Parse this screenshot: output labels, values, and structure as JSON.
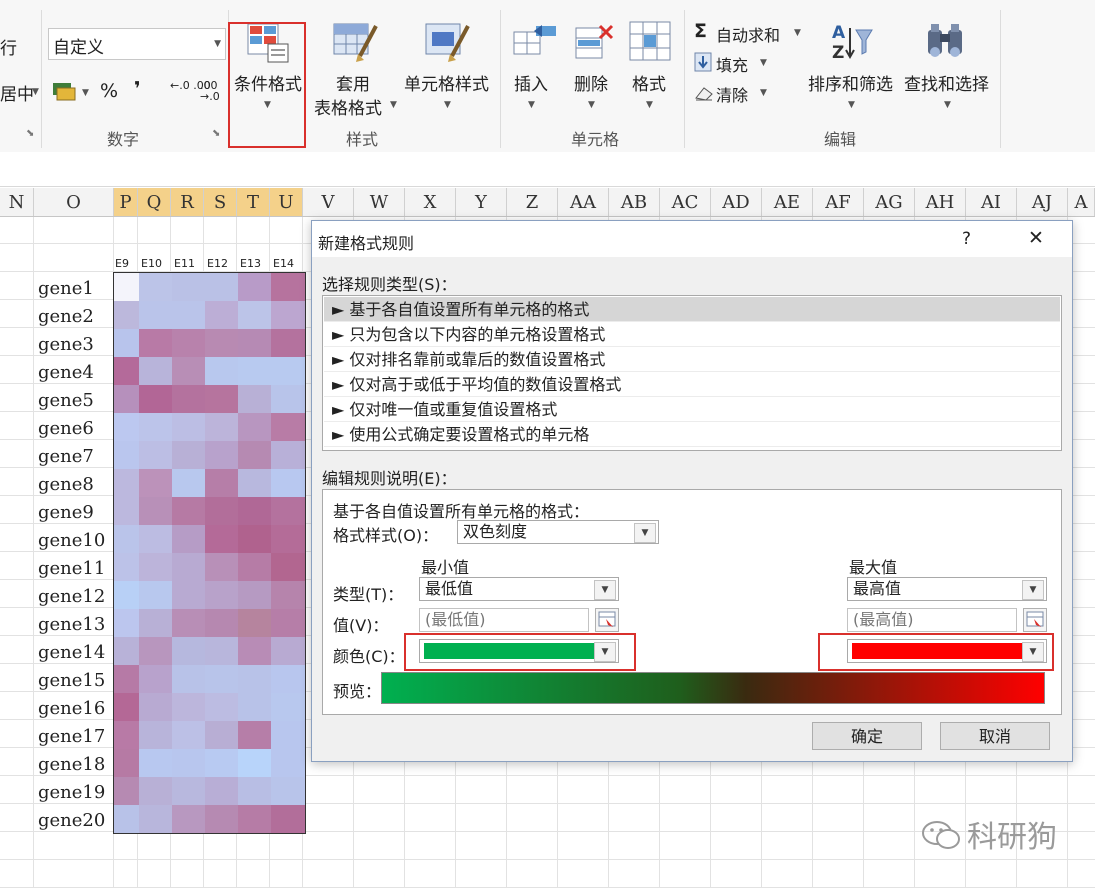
{
  "ribbon": {
    "left_partial_top": "行",
    "left_partial_bottom": "居中",
    "number_format_value": "自定义",
    "percent_glyph": "%",
    "comma_glyph": "❜",
    "decimal_increase": "←.0 .00",
    "decimal_decrease": ".00 →.0",
    "group_number_label": "数字",
    "conditional_format_label": "条件格式",
    "table_format_label_top": "套用",
    "table_format_label_bottom": "表格格式",
    "cell_style_label": "单元格样式",
    "group_styles_label": "样式",
    "insert_label": "插入",
    "delete_label": "删除",
    "format_label": "格式",
    "group_cells_label": "单元格",
    "autosum_glyph": "Σ",
    "autosum_label": "自动求和",
    "fill_label": "填充",
    "clear_label": "清除",
    "sort_filter_label": "排序和筛选",
    "find_select_label": "查找和选择",
    "group_edit_label": "编辑"
  },
  "sheet": {
    "columns": [
      "N",
      "O",
      "P",
      "Q",
      "R",
      "S",
      "T",
      "U",
      "V",
      "W",
      "X",
      "Y",
      "Z",
      "AA",
      "AB",
      "AC",
      "AD",
      "AE",
      "AF",
      "AG",
      "AH",
      "AI",
      "AJ",
      "A"
    ],
    "sample_headers": [
      "E9",
      "E10",
      "E11",
      "E12",
      "E13",
      "E14"
    ],
    "genes": [
      "gene1",
      "gene2",
      "gene3",
      "gene4",
      "gene5",
      "gene6",
      "gene7",
      "gene8",
      "gene9",
      "gene10",
      "gene11",
      "gene12",
      "gene13",
      "gene14",
      "gene15",
      "gene16",
      "gene17",
      "gene18",
      "gene19",
      "gene20"
    ],
    "heat_colors": [
      [
        "#f4f4fb",
        "#bcc4e8",
        "#bac1e6",
        "#bac1e6",
        "#b89bc8",
        "#b6739e"
      ],
      [
        "#bcb8dc",
        "#bac4ea",
        "#bac4ea",
        "#bcaed6",
        "#bcc4e8",
        "#bca6d0"
      ],
      [
        "#b8c4ec",
        "#b87aa6",
        "#b882ac",
        "#b88ab2",
        "#b68ab4",
        "#b4729e"
      ],
      [
        "#b46a9a",
        "#b8b4da",
        "#b88eb6",
        "#b8c8ee",
        "#b8caf0",
        "#b8caf0"
      ],
      [
        "#b690bc",
        "#b26696",
        "#b4729e",
        "#b6749e",
        "#b8b0d6",
        "#b8c4ea"
      ],
      [
        "#bcc8f0",
        "#bcc4ea",
        "#bcbee4",
        "#bcb4da",
        "#b896c0",
        "#b87ca6"
      ],
      [
        "#bac6ee",
        "#bcbee4",
        "#b8b0d6",
        "#b8a2cc",
        "#b68ab2",
        "#b8b0d8"
      ],
      [
        "#bcb8de",
        "#bc92ba",
        "#b8c8ee",
        "#b67ea8",
        "#b8b8de",
        "#b8c8f0"
      ],
      [
        "#bcb8de",
        "#b890b8",
        "#b67aa4",
        "#b26e9a",
        "#b06896",
        "#b4729e"
      ],
      [
        "#bac4ea",
        "#bcbce2",
        "#b69cc6",
        "#b46a98",
        "#b0628e",
        "#b46c98"
      ],
      [
        "#bcc2e8",
        "#bcb4da",
        "#b8aad2",
        "#b890b8",
        "#b67ca6",
        "#b26690"
      ],
      [
        "#b8d0f6",
        "#b8c8ee",
        "#b8aad2",
        "#b8a2ca",
        "#b69ac2",
        "#b684ac"
      ],
      [
        "#bcc6ee",
        "#b8b0d6",
        "#b88eb6",
        "#b688b0",
        "#b6849e",
        "#b67ea8"
      ],
      [
        "#b8b2d8",
        "#b896be",
        "#b6b8de",
        "#b8b6dc",
        "#b88cb6",
        "#b8aad2"
      ],
      [
        "#b67aa6",
        "#b8a2cc",
        "#b8c2e8",
        "#b8c4ea",
        "#b8c2e8",
        "#b8c6ee"
      ],
      [
        "#b46896",
        "#b8aad2",
        "#bcb6dc",
        "#bcbce2",
        "#b8c2e8",
        "#b8c8ee"
      ],
      [
        "#b87aa6",
        "#b8b4da",
        "#bcc0e6",
        "#b8aed4",
        "#b67ea8",
        "#b8c6ee"
      ],
      [
        "#b67aa4",
        "#b8c8f0",
        "#b8c6ee",
        "#b8caf2",
        "#b8d4fa",
        "#b8c6ee"
      ],
      [
        "#b68ab2",
        "#b8b0d6",
        "#b8b8de",
        "#b8aed6",
        "#b8bee4",
        "#b8c4ea"
      ],
      [
        "#b8c2e8",
        "#b8b6dc",
        "#b898c0",
        "#b68ab2",
        "#b67ca6",
        "#b26e9a"
      ]
    ]
  },
  "dialog": {
    "title": "新建格式规则",
    "help_glyph": "?",
    "close_glyph": "✕",
    "rule_type_label": "选择规则类型(S)：",
    "rules": [
      "► 基于各自值设置所有单元格的格式",
      "► 只为包含以下内容的单元格设置格式",
      "► 仅对排名靠前或靠后的数值设置格式",
      "► 仅对高于或低于平均值的数值设置格式",
      "► 仅对唯一值或重复值设置格式",
      "► 使用公式确定要设置格式的单元格"
    ],
    "edit_label": "编辑规则说明(E)：",
    "desc_heading": "基于各自值设置所有单元格的格式：",
    "format_style_label": "格式样式(O)：",
    "format_style_value": "双色刻度",
    "min_header": "最小值",
    "max_header": "最大值",
    "type_label": "类型(T)：",
    "type_min_value": "最低值",
    "type_max_value": "最高值",
    "value_label": "值(V)：",
    "value_min_placeholder": "(最低值)",
    "value_max_placeholder": "(最高值)",
    "color_label": "颜色(C)：",
    "min_color": "#00b050",
    "max_color": "#ff0000",
    "preview_label": "预览：",
    "ok_label": "确定",
    "cancel_label": "取消"
  },
  "watermark": "科研狗",
  "colors": {
    "highlight_frame": "#d9302c",
    "selected_col": "#f4d18a"
  }
}
